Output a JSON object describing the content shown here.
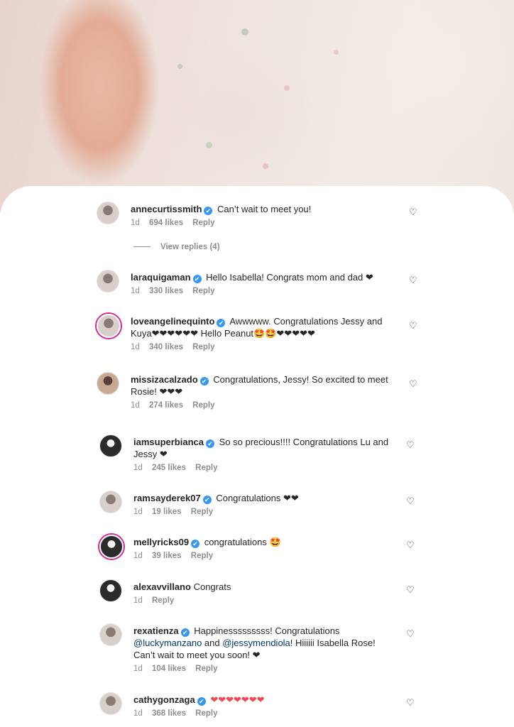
{
  "photo": {
    "subject": "baby-hand-icon"
  },
  "view_replies": "View replies (4)",
  "comments": [
    {
      "user": "annecurtissmith",
      "verified": true,
      "text": "Can’t wait to meet you!",
      "time": "1d",
      "likes": "694 likes",
      "reply": "Reply"
    },
    {
      "user": "laraquigaman",
      "verified": true,
      "text": "Hello Isabella! Congrats mom and dad ❤",
      "time": "1d",
      "likes": "330 likes",
      "reply": "Reply"
    },
    {
      "user": "loveangelinequinto",
      "verified": true,
      "text": "Awwwww. Congratulations Jessy and Kuya❤❤❤❤❤❤ Hello Peanut🤩🤩❤❤❤❤❤",
      "time": "1d",
      "likes": "340 likes",
      "reply": "Reply"
    },
    {
      "user": "missizacalzado",
      "verified": true,
      "text": "Congratulations, Jessy! So excited to meet Rosie! ❤❤❤",
      "time": "1d",
      "likes": "274 likes",
      "reply": "Reply"
    },
    {
      "user": "iamsuperbianca",
      "verified": true,
      "text": "So so precious!!!! Congratulations Lu and Jessy ❤",
      "time": "1d",
      "likes": "245 likes",
      "reply": "Reply"
    },
    {
      "user": "ramsayderek07",
      "verified": true,
      "text": "Congratulations ❤❤",
      "time": "1d",
      "likes": "19 likes",
      "reply": "Reply"
    },
    {
      "user": "mellyricks09",
      "verified": true,
      "text": "congratulations 🤩",
      "time": "1d",
      "likes": "39 likes",
      "reply": "Reply"
    },
    {
      "user": "alexavvillano",
      "verified": false,
      "text": "Congrats",
      "time": "1d",
      "likes": "",
      "reply": "Reply"
    },
    {
      "user": "rexatienza",
      "verified": true,
      "text_pre": "Happinesssssssss! Congratulations ",
      "mention1": "@luckymanzano",
      "text_mid": " and ",
      "mention2": "@jessymendiola",
      "text_post": "! Hiiiiii Isabella Rose! Can’t wait to meet you soon! ❤",
      "time": "1d",
      "likes": "104 likes",
      "reply": "Reply"
    },
    {
      "user": "cathygonzaga",
      "verified": true,
      "text": "❤❤❤❤❤❤❤",
      "time": "1d",
      "likes": "368 likes",
      "reply": "Reply"
    }
  ],
  "icons": {
    "verified": "✔",
    "like": "♡"
  }
}
